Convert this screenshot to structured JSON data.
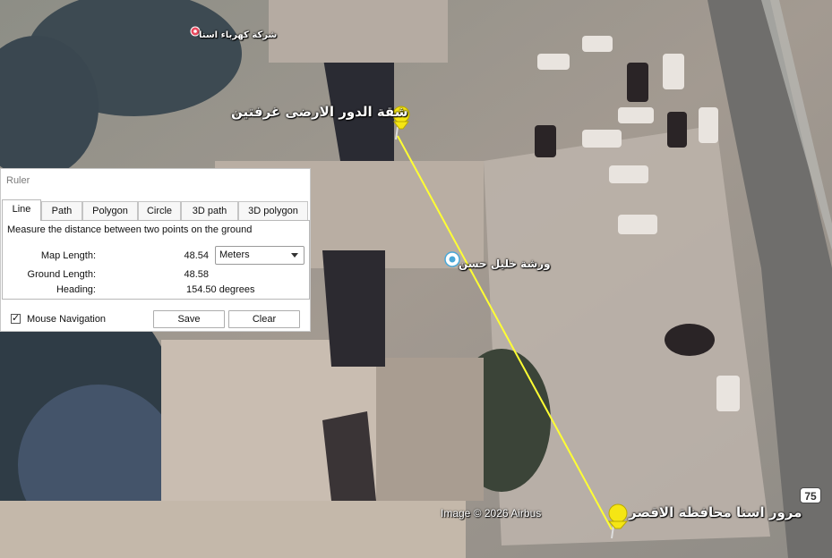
{
  "map": {
    "labels": {
      "top": "شقة الدور الارضى غرفتين",
      "middle": "ورشة خليل حسن",
      "bottom": "مرور اسنا محافظة الاقصر",
      "poi": "شركة كهرباء اسنا"
    },
    "attribution": "Image © 2026 Airbus",
    "road_shield": "75",
    "colors": {
      "ruler_line": "#ffff33",
      "pin": "#f5e614",
      "poi_marker": "#e84a5f",
      "place_marker": "#4aa8d8"
    }
  },
  "ruler": {
    "title": "Ruler",
    "tabs": [
      {
        "label": "Line",
        "active": true
      },
      {
        "label": "Path"
      },
      {
        "label": "Polygon"
      },
      {
        "label": "Circle"
      },
      {
        "label": "3D path"
      },
      {
        "label": "3D polygon"
      }
    ],
    "description": "Measure the distance between two points on the ground",
    "map_length_label": "Map Length:",
    "map_length_value": "48.54",
    "units_selected": "Meters",
    "ground_length_label": "Ground Length:",
    "ground_length_value": "48.58",
    "heading_label": "Heading:",
    "heading_value": "154.50 degrees",
    "mouse_navigation_label": "Mouse Navigation",
    "mouse_navigation_checked": true,
    "check_mark": "✓",
    "save_label": "Save",
    "clear_label": "Clear"
  }
}
